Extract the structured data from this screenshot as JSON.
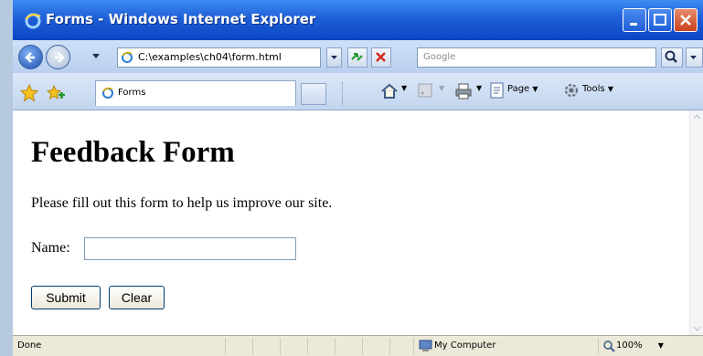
{
  "window": {
    "title": "Forms - Windows Internet Explorer"
  },
  "addressbar": {
    "url": "C:\\examples\\ch04\\form.html",
    "search_placeholder": "Google"
  },
  "tabs": [
    {
      "label": "Forms"
    }
  ],
  "commandbar": {
    "page_label": "Page",
    "tools_label": "Tools"
  },
  "page": {
    "heading": "Feedback Form",
    "intro": "Please fill out this form to help us improve our site.",
    "form": {
      "name_label": "Name:",
      "name_value": "",
      "submit_label": "Submit",
      "clear_label": "Clear"
    }
  },
  "statusbar": {
    "status": "Done",
    "zone": "My Computer",
    "zoom": "100%"
  },
  "colors": {
    "titlebar": "#1f5fd8",
    "accent": "#0a46c4"
  }
}
